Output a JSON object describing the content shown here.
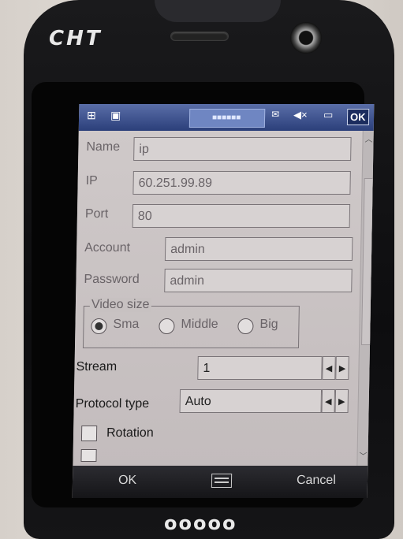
{
  "device": {
    "brand": "CHT",
    "logo": "ooooo"
  },
  "titlebar": {
    "app_tab_text": "■■■■■■",
    "ok_label": "OK"
  },
  "form": {
    "name_label": "Name",
    "name_value": "ip",
    "ip_label": "IP",
    "ip_value": "60.251.99.89",
    "port_label": "Port",
    "port_value": "80",
    "account_label": "Account",
    "account_value": "admin",
    "password_label": "Password",
    "password_value": "admin",
    "video_size": {
      "title": "Video size",
      "options": [
        "Sma",
        "Middle",
        "Big"
      ],
      "selected": "Sma"
    },
    "stream_label": "Stream",
    "stream_value": "1",
    "protocol_label": "Protocol type",
    "protocol_value": "Auto",
    "rotation_label": "Rotation"
  },
  "softkeys": {
    "left": "OK",
    "right": "Cancel"
  }
}
